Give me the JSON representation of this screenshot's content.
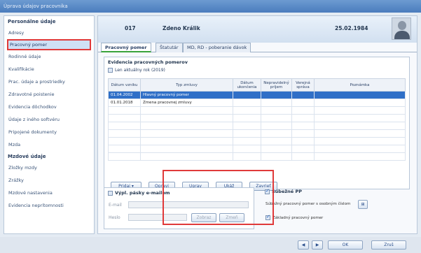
{
  "window": {
    "title": "Úprava údajov pracovníka"
  },
  "sidebar": {
    "section1": "Personálne údaje",
    "items1": [
      "Adresy",
      "Pracovný pomer",
      "Rodinné údaje",
      "Kvalifikácie",
      "Prac. údaje a prostriedky",
      "Zdravotné poistenie",
      "Evidencia dôchodkov",
      "Údaje z iného softvéru",
      "Pripojené dokumenty",
      "Mzda"
    ],
    "section2": "Mzdové údaje",
    "items2": [
      "Zložky mzdy",
      "Zrážky",
      "Mzdové nastavenia",
      "Evidencia neprítomnosti"
    ]
  },
  "header": {
    "code": "017",
    "name": "Zdeno Králik",
    "date": "25.02.1984"
  },
  "tabs": [
    "Pracovný pomer",
    "Štatutár",
    "MD, RD - poberanie dávok"
  ],
  "records": {
    "title": "Evidencia pracovných pomerov",
    "filter_label": "Len aktuálny rok (2019)",
    "columns": [
      "Dátum vzniku",
      "Typ zmluvy",
      "Dátum ukončenia",
      "Nepravidelný príjem",
      "Verejná správa",
      "Poznámka"
    ],
    "rows": [
      {
        "date": "01.04.2002",
        "type": "Hlavný pracovný pomer"
      },
      {
        "date": "01.01.2018",
        "type": "Zmena pracovnej zmluvy"
      }
    ]
  },
  "buttons": {
    "add": "Pridaj",
    "copy": "Opravi",
    "edit": "Uprav",
    "delete": "Ukáž",
    "undo": "Zavrieť"
  },
  "payslip": {
    "title": "Výpl. pásky e-mailom",
    "email_label": "E-mail",
    "password_label": "Heslo",
    "btn1": "Zobraz",
    "btn2": "Zmeň"
  },
  "concurrent": {
    "title": "Súbežné PP",
    "desc": "Súbežný pracovný pomer s osobným číslom",
    "main_label": "Základný pracovný pomer"
  },
  "footer": {
    "ok": "OK",
    "cancel": "Zruš"
  }
}
